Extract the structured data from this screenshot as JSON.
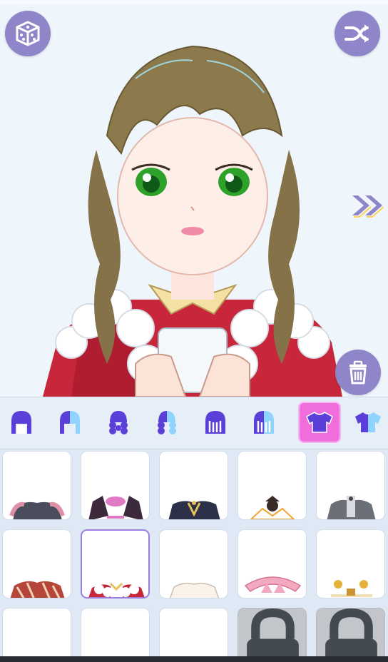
{
  "app": {
    "screen": "dress-up-editor",
    "accent_color": "#8e86c8",
    "selected_category_color": "#f06edc"
  },
  "toolbar": {
    "random_icon": "dice-icon",
    "shuffle_icon": "shuffle-icon",
    "next_icon": "double-chevron-right-icon",
    "delete_icon": "trash-icon"
  },
  "categories": [
    {
      "icon": "front-hair-icon",
      "selected": false
    },
    {
      "icon": "front-hair-color-icon",
      "selected": false
    },
    {
      "icon": "back-hair-icon",
      "selected": false
    },
    {
      "icon": "back-hair-color-icon",
      "selected": false
    },
    {
      "icon": "hair-accessory-icon",
      "selected": false
    },
    {
      "icon": "hair-accessory-color-icon",
      "selected": false
    },
    {
      "icon": "top-shirt-icon",
      "selected": true
    },
    {
      "icon": "top-shirt-color-icon",
      "selected": false
    }
  ],
  "items": [
    {
      "row": 1,
      "col": 1,
      "icon": "dark-ruffle-collar-outfit",
      "selected": false,
      "locked": false
    },
    {
      "row": 1,
      "col": 2,
      "icon": "feathered-pink-bow-outfit",
      "selected": false,
      "locked": false
    },
    {
      "row": 1,
      "col": 3,
      "icon": "navy-gold-cape-outfit",
      "selected": false,
      "locked": false
    },
    {
      "row": 1,
      "col": 4,
      "icon": "witch-collar-outfit",
      "selected": false,
      "locked": false
    },
    {
      "row": 1,
      "col": 5,
      "icon": "gray-frilled-dress-outfit",
      "selected": false,
      "locked": false
    },
    {
      "row": 2,
      "col": 1,
      "icon": "plaid-red-top-outfit",
      "selected": false,
      "locked": false
    },
    {
      "row": 2,
      "col": 2,
      "icon": "red-fur-trim-outfit",
      "selected": true,
      "locked": false
    },
    {
      "row": 2,
      "col": 3,
      "icon": "cream-blouse-outfit",
      "selected": false,
      "locked": false
    },
    {
      "row": 2,
      "col": 4,
      "icon": "pink-ribbon-top-outfit",
      "selected": false,
      "locked": false
    },
    {
      "row": 2,
      "col": 5,
      "icon": "gold-bear-bow-outfit",
      "selected": false,
      "locked": false
    },
    {
      "row": 3,
      "col": 1,
      "icon": "outfit-item",
      "selected": false,
      "locked": false
    },
    {
      "row": 3,
      "col": 2,
      "icon": "outfit-item",
      "selected": false,
      "locked": false
    },
    {
      "row": 3,
      "col": 3,
      "icon": "outfit-item",
      "selected": false,
      "locked": false
    },
    {
      "row": 3,
      "col": 4,
      "icon": "lock-icon",
      "selected": false,
      "locked": true
    },
    {
      "row": 3,
      "col": 5,
      "icon": "lock-icon",
      "selected": false,
      "locked": true
    }
  ]
}
